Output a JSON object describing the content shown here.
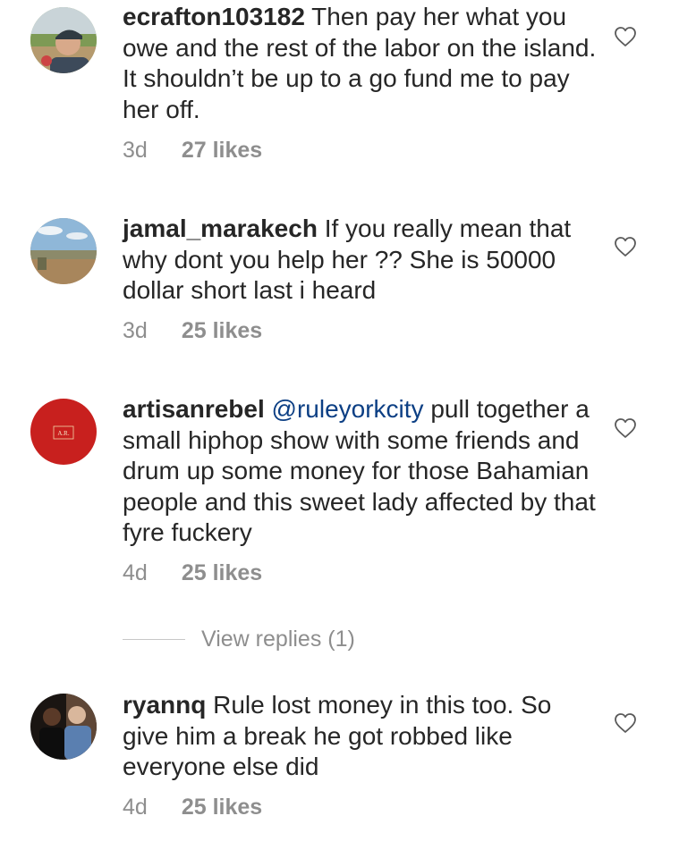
{
  "comments": [
    {
      "username": "ecrafton103182",
      "mention": "",
      "text": " Then pay her what you owe and the rest of the labor on the island. It shouldn’t be up to a go fund me to pay her off.",
      "time": "3d",
      "likes": "27 likes",
      "avatar": "user-photo-outdoor",
      "like_icon": "heart-outline-icon"
    },
    {
      "username": "jamal_marakech",
      "mention": "",
      "text": " If you really mean that why dont you help her ?? She is 50000 dollar  short last i heard",
      "time": "3d",
      "likes": "25 likes",
      "avatar": "landscape-photo",
      "like_icon": "heart-outline-icon"
    },
    {
      "username": "artisanrebel",
      "mention": " @ruleyorkcity",
      "text": " pull together a small hiphop show with some friends and drum up some money for those Bahamian people and this sweet lady affected by that fyre fuckery",
      "time": "4d",
      "likes": "25 likes",
      "avatar": "red-logo",
      "avatar_text": "A.R.",
      "like_icon": "heart-outline-icon"
    },
    {
      "username": "ryannq",
      "mention": "",
      "text": " Rule lost money in this too. So give him a break he got robbed like everyone else did",
      "time": "4d",
      "likes": "25 likes",
      "avatar": "two-people-photo",
      "like_icon": "heart-outline-icon"
    }
  ],
  "view_replies": "View replies (1)",
  "colors": {
    "text": "#262626",
    "meta": "#8e8e8e",
    "mention": "#0c3f84"
  }
}
